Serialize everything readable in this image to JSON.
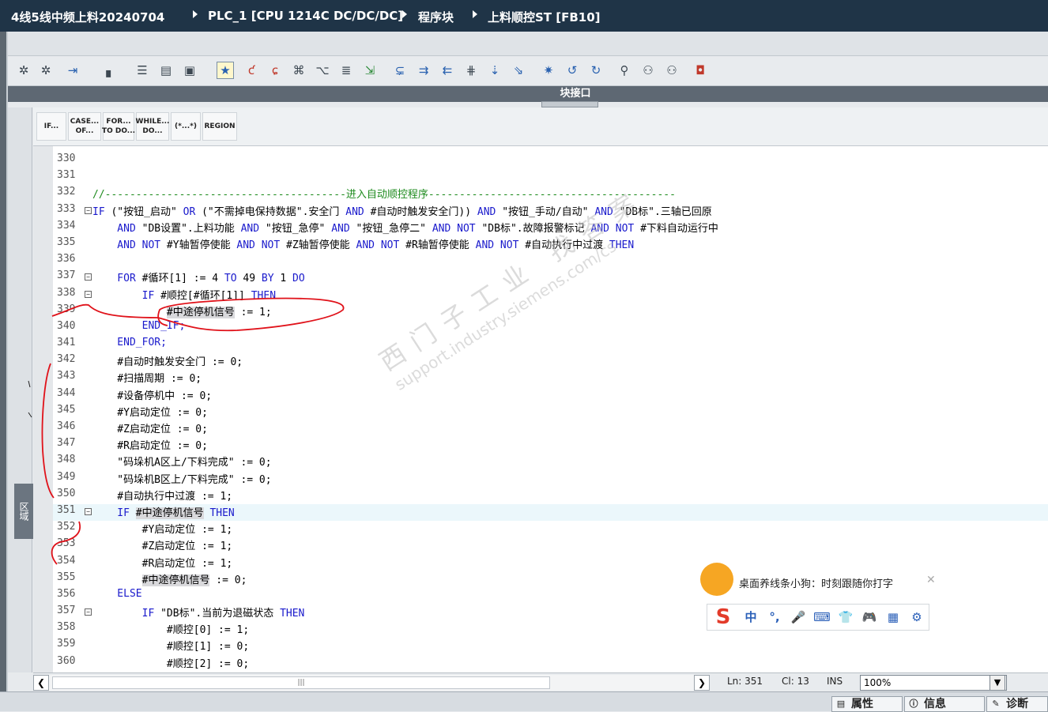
{
  "breadcrumb": {
    "items": [
      "4线5线中频上料20240704",
      "PLC_1 [CPU 1214C DC/DC/DC]",
      "程序块",
      "上料顺控ST [FB10]"
    ]
  },
  "toolbar": {
    "icons": [
      "insert-network-icon",
      "delete-network-icon",
      "insert-row-icon",
      "insert-blank-icon",
      "list-icon",
      "table-icon",
      "monitor-icon",
      "favorite-icon",
      "remove-breakpoint-icon",
      "breakpoint-icon",
      "indent-icon",
      "outdent-icon",
      "comment-icon",
      "uncomment-icon",
      "collapse-icon",
      "expand-icon",
      "bookmark-icon",
      "goto-icon",
      "prev-bookmark-icon",
      "next-bookmark-icon",
      "compare-icon",
      "monitor-on-icon",
      "monitor-off-icon",
      "db-icon"
    ]
  },
  "interface_bar": {
    "label": "块接口"
  },
  "region_tab": {
    "label": "区域"
  },
  "palette": {
    "buttons": [
      "IF...",
      "CASE...\nOF...",
      "FOR...\nTO DO...",
      "WHILE...\nDO...",
      "(*...*)",
      "REGION"
    ]
  },
  "code": {
    "lines": [
      {
        "n": "330",
        "fold": "",
        "segs": []
      },
      {
        "n": "331",
        "fold": "",
        "segs": []
      },
      {
        "n": "332",
        "fold": "",
        "segs": [
          {
            "t": "//---------------------------------------进入自动顺控程序----------------------------------------",
            "c": "cm"
          }
        ]
      },
      {
        "n": "333",
        "fold": "⊟",
        "segs": [
          {
            "t": "IF ",
            "c": "kw"
          },
          {
            "t": "(\"按钮_启动\" ",
            "c": "txt"
          },
          {
            "t": "OR ",
            "c": "kw"
          },
          {
            "t": "(\"不需掉电保持数据\".安全门 ",
            "c": "txt"
          },
          {
            "t": "AND ",
            "c": "kw"
          },
          {
            "t": "#自动时触发安全门)) ",
            "c": "txt"
          },
          {
            "t": "AND ",
            "c": "kw"
          },
          {
            "t": "\"按钮_手动/自动\" ",
            "c": "txt"
          },
          {
            "t": "AND ",
            "c": "kw"
          },
          {
            "t": "\"DB标\".三轴已回原",
            "c": "txt"
          }
        ]
      },
      {
        "n": "334",
        "fold": "",
        "segs": [
          {
            "t": "    AND ",
            "c": "kw"
          },
          {
            "t": "\"DB设置\".上料功能 ",
            "c": "txt"
          },
          {
            "t": "AND ",
            "c": "kw"
          },
          {
            "t": "\"按钮_急停\" ",
            "c": "txt"
          },
          {
            "t": "AND ",
            "c": "kw"
          },
          {
            "t": "\"按钮_急停二\" ",
            "c": "txt"
          },
          {
            "t": "AND NOT ",
            "c": "kw"
          },
          {
            "t": "\"DB标\".故障报警标记 ",
            "c": "txt"
          },
          {
            "t": "AND NOT ",
            "c": "kw"
          },
          {
            "t": "#下料自动运行中",
            "c": "txt"
          }
        ]
      },
      {
        "n": "335",
        "fold": "",
        "segs": [
          {
            "t": "    AND NOT ",
            "c": "kw"
          },
          {
            "t": "#Y轴暂停使能 ",
            "c": "txt"
          },
          {
            "t": "AND NOT ",
            "c": "kw"
          },
          {
            "t": "#Z轴暂停使能 ",
            "c": "txt"
          },
          {
            "t": "AND NOT ",
            "c": "kw"
          },
          {
            "t": "#R轴暂停使能 ",
            "c": "txt"
          },
          {
            "t": "AND NOT ",
            "c": "kw"
          },
          {
            "t": "#自动执行中过渡 ",
            "c": "txt"
          },
          {
            "t": "THEN",
            "c": "kw"
          }
        ]
      },
      {
        "n": "336",
        "fold": "",
        "segs": []
      },
      {
        "n": "337",
        "fold": "⊟",
        "segs": [
          {
            "t": "    FOR ",
            "c": "kw"
          },
          {
            "t": "#循环[1] := 4 ",
            "c": "txt"
          },
          {
            "t": "TO ",
            "c": "kw"
          },
          {
            "t": "49 ",
            "c": "txt"
          },
          {
            "t": "BY ",
            "c": "kw"
          },
          {
            "t": "1 ",
            "c": "txt"
          },
          {
            "t": "DO",
            "c": "kw"
          }
        ]
      },
      {
        "n": "338",
        "fold": "⊟",
        "segs": [
          {
            "t": "        IF ",
            "c": "kw"
          },
          {
            "t": "#顺控[#循环[1]] ",
            "c": "txt"
          },
          {
            "t": "THEN",
            "c": "kw"
          }
        ]
      },
      {
        "n": "339",
        "fold": "",
        "segs": [
          {
            "t": "            ",
            "c": "txt"
          },
          {
            "t": "#中途停机信号",
            "c": "txt hl"
          },
          {
            "t": " := 1;",
            "c": "txt"
          }
        ]
      },
      {
        "n": "340",
        "fold": "",
        "segs": [
          {
            "t": "        END_IF;",
            "c": "kw"
          }
        ]
      },
      {
        "n": "341",
        "fold": "",
        "segs": [
          {
            "t": "    END_FOR;",
            "c": "kw"
          }
        ]
      },
      {
        "n": "342",
        "fold": "",
        "segs": [
          {
            "t": "    #自动时触发安全门 := 0;",
            "c": "txt"
          }
        ]
      },
      {
        "n": "343",
        "fold": "",
        "segs": [
          {
            "t": "    #扫描周期 := 0;",
            "c": "txt"
          }
        ]
      },
      {
        "n": "344",
        "fold": "",
        "segs": [
          {
            "t": "    #设备停机中 := 0;",
            "c": "txt"
          }
        ]
      },
      {
        "n": "345",
        "fold": "",
        "segs": [
          {
            "t": "    #Y启动定位 := 0;",
            "c": "txt"
          }
        ]
      },
      {
        "n": "346",
        "fold": "",
        "segs": [
          {
            "t": "    #Z启动定位 := 0;",
            "c": "txt"
          }
        ]
      },
      {
        "n": "347",
        "fold": "",
        "segs": [
          {
            "t": "    #R启动定位 := 0;",
            "c": "txt"
          }
        ]
      },
      {
        "n": "348",
        "fold": "",
        "segs": [
          {
            "t": "    \"码垛机A区上/下料完成\" := 0;",
            "c": "txt"
          }
        ]
      },
      {
        "n": "349",
        "fold": "",
        "segs": [
          {
            "t": "    \"码垛机B区上/下料完成\" := 0;",
            "c": "txt"
          }
        ]
      },
      {
        "n": "350",
        "fold": "",
        "segs": [
          {
            "t": "    #自动执行中过渡 := 1;",
            "c": "txt"
          }
        ]
      },
      {
        "n": "351",
        "fold": "⊟",
        "segs": [
          {
            "t": "    IF ",
            "c": "kw"
          },
          {
            "t": "#中途停机信号",
            "c": "txt hl"
          },
          {
            "t": " ",
            "c": "txt"
          },
          {
            "t": "THEN",
            "c": "kw"
          }
        ]
      },
      {
        "n": "352",
        "fold": "",
        "segs": [
          {
            "t": "        #Y启动定位 := 1;",
            "c": "txt"
          }
        ]
      },
      {
        "n": "353",
        "fold": "",
        "segs": [
          {
            "t": "        #Z启动定位 := 1;",
            "c": "txt"
          }
        ]
      },
      {
        "n": "354",
        "fold": "",
        "segs": [
          {
            "t": "        #R启动定位 := 1;",
            "c": "txt"
          }
        ]
      },
      {
        "n": "355",
        "fold": "",
        "segs": [
          {
            "t": "        ",
            "c": "txt"
          },
          {
            "t": "#中途停机信号",
            "c": "txt hl"
          },
          {
            "t": " := 0;",
            "c": "txt"
          }
        ]
      },
      {
        "n": "356",
        "fold": "",
        "segs": [
          {
            "t": "    ELSE",
            "c": "kw"
          }
        ]
      },
      {
        "n": "357",
        "fold": "⊟",
        "segs": [
          {
            "t": "        IF ",
            "c": "kw"
          },
          {
            "t": "\"DB标\".当前为退磁状态 ",
            "c": "txt"
          },
          {
            "t": "THEN",
            "c": "kw"
          }
        ]
      },
      {
        "n": "358",
        "fold": "",
        "segs": [
          {
            "t": "            #顺控[0] := 1;",
            "c": "txt"
          }
        ]
      },
      {
        "n": "359",
        "fold": "",
        "segs": [
          {
            "t": "            #顺控[1] := 0;",
            "c": "txt"
          }
        ]
      },
      {
        "n": "360",
        "fold": "",
        "segs": [
          {
            "t": "            #顺控[2] := 0;",
            "c": "txt"
          }
        ]
      }
    ]
  },
  "status": {
    "ln": "Ln: 351",
    "cl": "Cl: 13",
    "mode": "INS",
    "zoom": "100%"
  },
  "footer": {
    "tabs": [
      {
        "label": "属性",
        "icon": "properties-icon"
      },
      {
        "label": "信息",
        "icon": "info-icon"
      },
      {
        "label": "诊断",
        "icon": "diagnostics-icon"
      }
    ]
  },
  "ime": {
    "tip": "桌面养线条小狗：时刻跟随你打字",
    "items": [
      "中",
      "°,",
      "🎤",
      "⌨",
      "👕",
      "🎮",
      "▦",
      "⚙"
    ]
  },
  "watermark": {
    "line1": "西门子工业  找答案",
    "line2": "support.industry.siemens.com/cs"
  },
  "colors": {
    "keyword": "#1a1acc",
    "comment": "#1e8b1e",
    "title_bar": "#1f3447",
    "current_line": "#ebf7fb",
    "annotation": "#e0121a"
  }
}
